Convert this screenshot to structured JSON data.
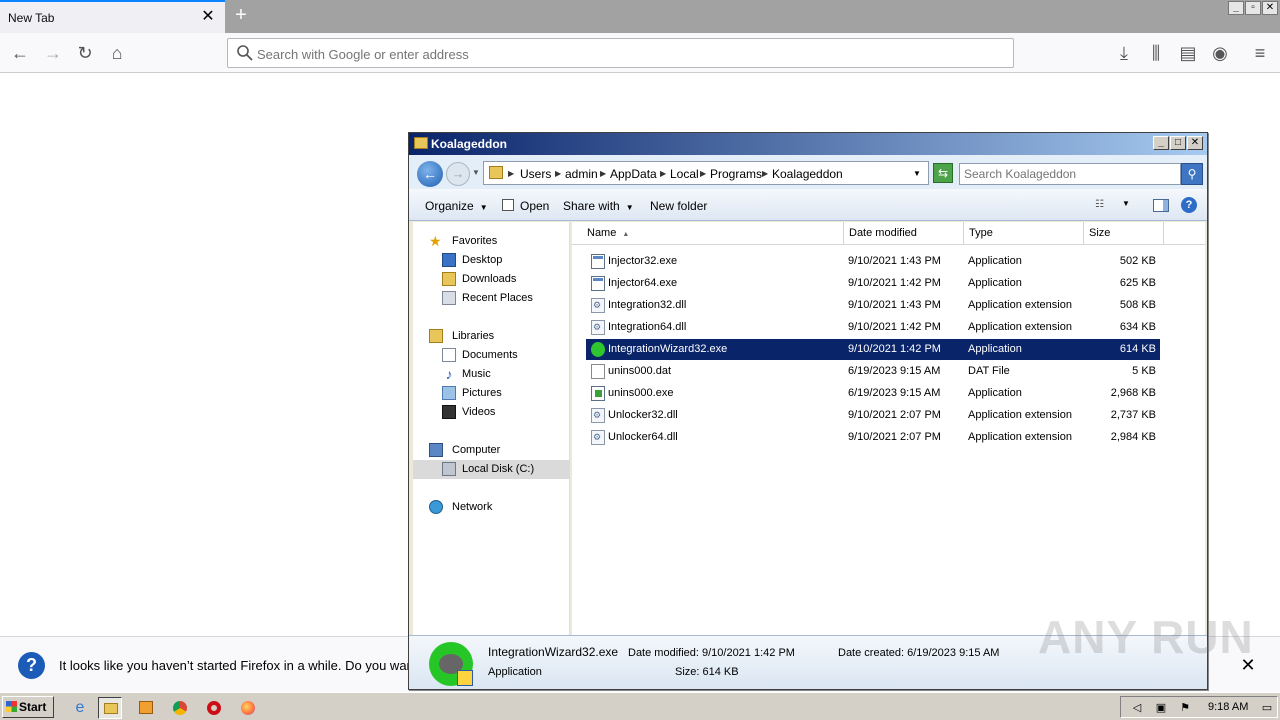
{
  "firefox": {
    "tab_title": "New Tab",
    "tab_close": "✕",
    "new_tab": "+",
    "urlbar_placeholder": "Search with Google or enter address",
    "notification_text": "It looks like you haven’t started Firefox in a while. Do you wan",
    "notification_close": "✕",
    "window_controls": [
      "_",
      "▫",
      "✕"
    ]
  },
  "explorer": {
    "title": "Koalageddon",
    "breadcrumb": [
      "Users",
      "admin",
      "AppData",
      "Local",
      "Programs",
      "Koalageddon"
    ],
    "search_placeholder": "Search Koalageddon",
    "toolbar": {
      "organize": "Organize",
      "open": "Open",
      "share_with": "Share with",
      "new_folder": "New folder",
      "help": "?"
    },
    "nav": {
      "favorites": "Favorites",
      "desktop": "Desktop",
      "downloads": "Downloads",
      "recent_places": "Recent Places",
      "libraries": "Libraries",
      "documents": "Documents",
      "music": "Music",
      "pictures": "Pictures",
      "videos": "Videos",
      "computer": "Computer",
      "local_disk": "Local Disk (C:)",
      "network": "Network"
    },
    "columns": {
      "name": "Name",
      "date_modified": "Date modified",
      "type": "Type",
      "size": "Size"
    },
    "files": [
      {
        "name": "Injector32.exe",
        "date": "9/10/2021 1:43 PM",
        "type": "Application",
        "size": "502 KB",
        "icon": "exe-icon"
      },
      {
        "name": "Injector64.exe",
        "date": "9/10/2021 1:42 PM",
        "type": "Application",
        "size": "625 KB",
        "icon": "exe-icon"
      },
      {
        "name": "Integration32.dll",
        "date": "9/10/2021 1:43 PM",
        "type": "Application extension",
        "size": "508 KB",
        "icon": "dll-icon"
      },
      {
        "name": "Integration64.dll",
        "date": "9/10/2021 1:42 PM",
        "type": "Application extension",
        "size": "634 KB",
        "icon": "dll-icon"
      },
      {
        "name": "IntegrationWizard32.exe",
        "date": "9/10/2021 1:42 PM",
        "type": "Application",
        "size": "614 KB",
        "icon": "koala-icon",
        "selected": true
      },
      {
        "name": "unins000.dat",
        "date": "6/19/2023 9:15 AM",
        "type": "DAT File",
        "size": "5 KB",
        "icon": "dat-icon"
      },
      {
        "name": "unins000.exe",
        "date": "6/19/2023 9:15 AM",
        "type": "Application",
        "size": "2,968 KB",
        "icon": "uninstaller-icon"
      },
      {
        "name": "Unlocker32.dll",
        "date": "9/10/2021 2:07 PM",
        "type": "Application extension",
        "size": "2,737 KB",
        "icon": "dll-icon"
      },
      {
        "name": "Unlocker64.dll",
        "date": "9/10/2021 2:07 PM",
        "type": "Application extension",
        "size": "2,984 KB",
        "icon": "dll-icon"
      }
    ],
    "details": {
      "name": "IntegrationWizard32.exe",
      "type": "Application",
      "date_modified": "Date modified: 9/10/2021 1:42 PM",
      "size": "Size: 614 KB",
      "date_created": "Date created: 6/19/2023 9:15 AM"
    }
  },
  "taskbar": {
    "start": "Start",
    "clock": "9:18 AM"
  },
  "watermark": "ANY RUN",
  "colors": {
    "selection": "#0a246a",
    "titlebar_start": "#0a246a",
    "titlebar_end": "#a6caf0",
    "firefox_accent": "#0a84ff"
  }
}
